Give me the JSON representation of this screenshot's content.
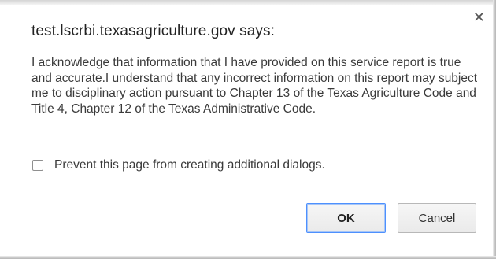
{
  "dialog": {
    "title": "test.lscrbi.texasagriculture.gov says:",
    "close_icon": "✕",
    "message": "I acknowledge that information that I have provided on this service report is true and accurate.I understand that any incorrect information on this report may subject me to disciplinary action pursuant to Chapter 13 of the Texas Agriculture Code and Title 4, Chapter 12 of the Texas Administrative Code.",
    "prevent_label": "Prevent this page from creating additional dialogs.",
    "prevent_checked": false,
    "ok_label": "OK",
    "cancel_label": "Cancel"
  },
  "colors": {
    "ok_border": "#4d90fe",
    "text": "#3a3a3a"
  }
}
